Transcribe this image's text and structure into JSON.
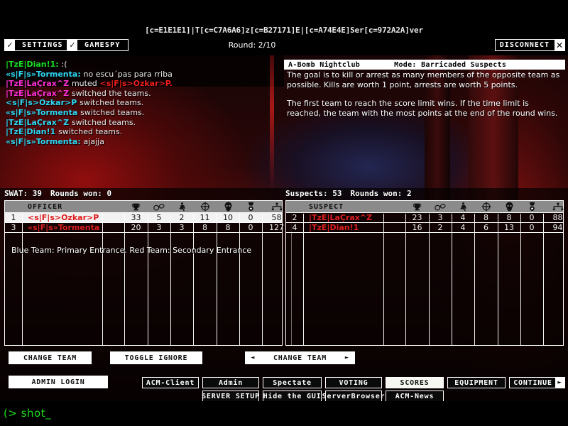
{
  "window": {
    "server_title": "[c=E1E1E1]|T[c=C7A6A6]z[c=B27171]E|[c=A74E4E]Ser[c=972A2A]ver",
    "round_label": "Round: 2/10"
  },
  "topbar": {
    "settings_label": "SETTINGS",
    "settings_check": "✓",
    "gamespy_label": "GAMESPY",
    "gamespy_check": "✓",
    "disconnect_label": "DISCONNECT",
    "disconnect_x": "✕"
  },
  "chat": {
    "lines": [
      {
        "name": "|TzE|Dian!1",
        "name_color": "green",
        "sep": ": ",
        "text": ":(",
        "text_color": "white"
      },
      {
        "name": "«sF|s»Tormenta",
        "name_display": "«s|F|s»Tormenta",
        "name_color": "cyan",
        "sep": ":   ",
        "text": "no escu´pas para rriba",
        "text_color": "white"
      },
      {
        "name": "|TzE|LaÇrax^Z",
        "name_color": "magenta",
        "sep": " ",
        "text": "muted",
        "text_color": "white",
        "suffix": "<s|F|s>Ozkar>P.",
        "suffix_color": "red"
      },
      {
        "name": "|TzE|LaÇrax^Z",
        "name_color": "magenta",
        "sep": " ",
        "text": "switched the teams.",
        "text_color": "white"
      },
      {
        "name": "<s|F|s>Ozkar>P",
        "name_color": "cyan",
        "sep": " ",
        "text": "switched teams.",
        "text_color": "white"
      },
      {
        "name": "«s|F|s»Tormenta",
        "name_color": "cyan",
        "sep": " ",
        "text": "switched teams.",
        "text_color": "white"
      },
      {
        "name": "|TzE|LaÇrax^Z",
        "name_color": "cyan",
        "sep": " ",
        "text": "switched teams.",
        "text_color": "white"
      },
      {
        "name": "|TzE|Dian!1",
        "name_color": "cyan",
        "sep": " ",
        "text": "switched teams.",
        "text_color": "white"
      },
      {
        "name": "«s|F|s»Tormenta",
        "name_color": "cyan",
        "sep": ":  ",
        "text": "ajajja",
        "text_color": "white"
      }
    ]
  },
  "briefing": {
    "map_name": "A-Bomb Nightclub",
    "mode_label": "Mode: Barricaded Suspects",
    "paragraph1": "The goal is to kill or arrest as many members of the opposite team as possible.  Kills are worth 1 point, arrests are worth 5 points.",
    "paragraph2": "The first team to reach the score limit wins.  If the time limit is reached, the team with the most points at the end of the round wins."
  },
  "scoreboards": {
    "column_icons": [
      "trophy-icon",
      "handcuffs-icon",
      "arrested-person-icon",
      "crosshair-icon",
      "skull-icon",
      "medal-icon",
      "ping-icon"
    ],
    "swat": {
      "team_label": "SWAT: 39",
      "rounds_won_label": "Rounds won: 0",
      "header_role": "OFFICER",
      "rows": [
        {
          "rank": "1",
          "name": "<s|F|s>Ozkar>P",
          "values": [
            "33",
            "5",
            "2",
            "11",
            "10",
            "0",
            "58"
          ],
          "highlight": true
        },
        {
          "rank": "3",
          "name": "«s|F|s»Tormenta",
          "values": [
            "20",
            "3",
            "3",
            "8",
            "8",
            "0",
            "127"
          ],
          "highlight": false
        }
      ],
      "team_note": "Blue Team: Primary Entrance. Red Team: Secondary Entrance"
    },
    "suspects": {
      "team_label": "Suspects: 53",
      "rounds_won_label": "Rounds won: 2",
      "header_role": "SUSPECT",
      "rows": [
        {
          "rank": "2",
          "name": "|TzE|LaÇrax^Z",
          "values": [
            "23",
            "3",
            "4",
            "8",
            "8",
            "0",
            "88"
          ],
          "highlight": false
        },
        {
          "rank": "4",
          "name": "|TzE|Dian!1",
          "values": [
            "16",
            "2",
            "4",
            "6",
            "13",
            "0",
            "94"
          ],
          "highlight": false
        }
      ],
      "team_note": ""
    }
  },
  "actions": {
    "change_team_left": "CHANGE TEAM",
    "toggle_ignore": "TOGGLE IGNORE",
    "change_team_spin": "CHANGE TEAM",
    "arrow_left": "◄",
    "arrow_right": "►",
    "admin_login": "ADMIN LOGIN"
  },
  "mod_buttons": {
    "row1": [
      "ACM-Client",
      "Admin",
      "Spectate",
      "VOTING",
      "SCORES",
      "EQUIPMENT",
      "CONTINUE"
    ],
    "row2": [
      "SERVER SETUP",
      "Hide the GUI",
      "ServerBrowser",
      "ACM-News"
    ],
    "active": "SCORES",
    "continue_arrow": "►"
  },
  "console": {
    "prompt_text": "(> shot_"
  },
  "colors": {
    "chat_green": "#19e024",
    "chat_cyan": "#2fd8f4",
    "chat_magenta": "#ff2fd2",
    "chat_red": "#f21c1c",
    "console_green": "#1ddc1d",
    "header_gray": "#8b8b8b",
    "player_name_red": "#e01b1b"
  }
}
